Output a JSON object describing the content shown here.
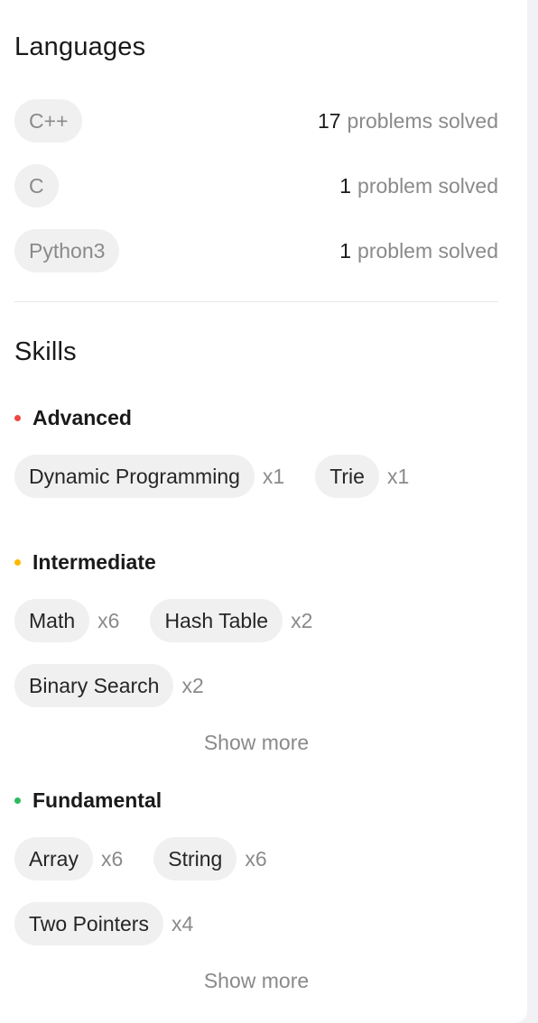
{
  "languages": {
    "title": "Languages",
    "items": [
      {
        "name": "C++",
        "count": "17",
        "suffix": "problems solved"
      },
      {
        "name": "C",
        "count": "1",
        "suffix": "problem solved"
      },
      {
        "name": "Python3",
        "count": "1",
        "suffix": "problem solved"
      }
    ]
  },
  "skills": {
    "title": "Skills",
    "advanced": {
      "label": "Advanced",
      "color": "#ef4743",
      "tags": [
        {
          "name": "Dynamic Programming",
          "count": "x1"
        },
        {
          "name": "Trie",
          "count": "x1"
        }
      ]
    },
    "intermediate": {
      "label": "Intermediate",
      "color": "#ffb800",
      "tags": [
        {
          "name": "Math",
          "count": "x6"
        },
        {
          "name": "Hash Table",
          "count": "x2"
        },
        {
          "name": "Binary Search",
          "count": "x2"
        }
      ],
      "show_more": "Show more"
    },
    "fundamental": {
      "label": "Fundamental",
      "color": "#2cbb5d",
      "tags": [
        {
          "name": "Array",
          "count": "x6"
        },
        {
          "name": "String",
          "count": "x6"
        },
        {
          "name": "Two Pointers",
          "count": "x4"
        }
      ],
      "show_more": "Show more"
    }
  }
}
